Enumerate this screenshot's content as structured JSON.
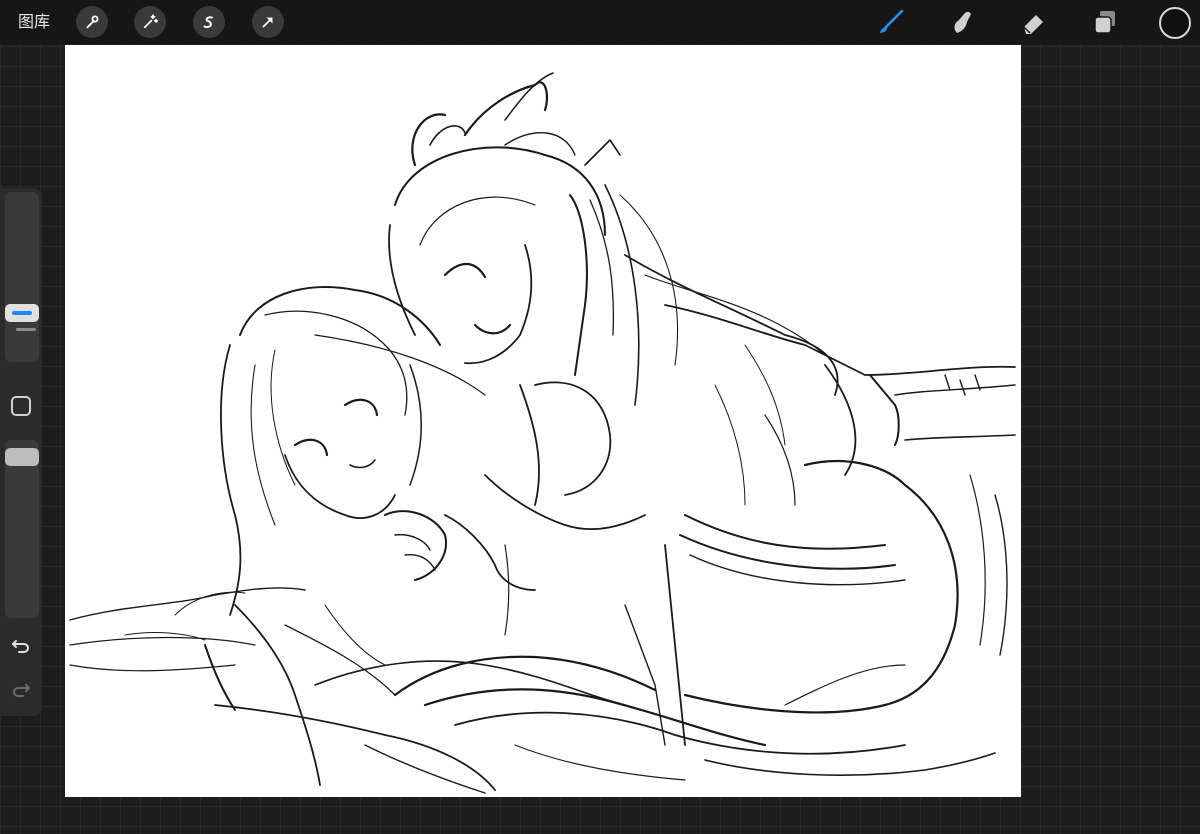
{
  "topbar": {
    "gallery_label": "图库",
    "left_tools": [
      {
        "name": "actions",
        "icon": "wrench-icon"
      },
      {
        "name": "adjustments",
        "icon": "magic-wand-icon"
      },
      {
        "name": "selection",
        "icon": "selection-s-icon"
      },
      {
        "name": "transform",
        "icon": "arrow-cursor-icon"
      }
    ],
    "right_tools": [
      {
        "name": "brush",
        "icon": "brush-icon",
        "active": true
      },
      {
        "name": "smudge",
        "icon": "smudge-icon",
        "active": false
      },
      {
        "name": "eraser",
        "icon": "eraser-icon",
        "active": false
      },
      {
        "name": "layers",
        "icon": "layers-icon",
        "active": false
      }
    ],
    "current_color": "#111111"
  },
  "sidebar": {
    "brush_size_label_icon": "size-slider",
    "modify_icon": "square-modify-icon",
    "undo_icon": "undo-icon",
    "redo_icon": "redo-icon"
  },
  "colors": {
    "accent": "#1e88ff",
    "toolbar_bg": "#161616",
    "canvas_bg": "#ffffff",
    "ink": "#1a1a1a"
  }
}
